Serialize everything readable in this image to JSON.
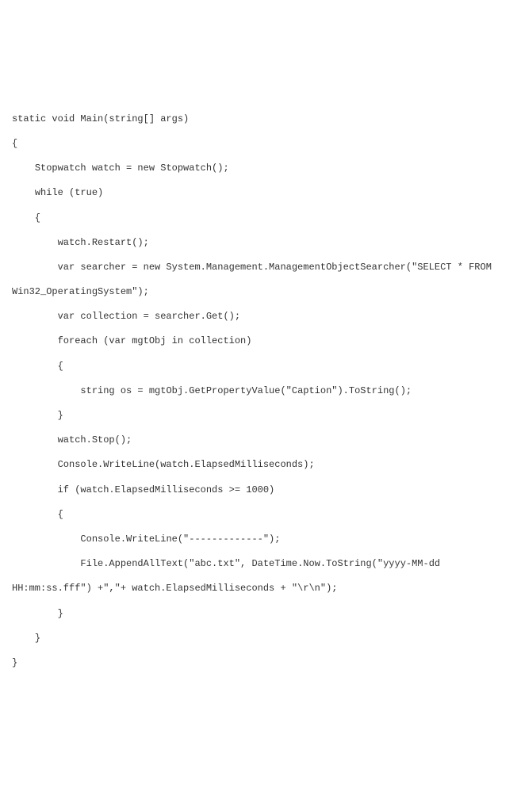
{
  "code": {
    "lines": [
      "static void Main(string[] args)",
      "{",
      "    Stopwatch watch = new Stopwatch();",
      "    while (true)",
      "    {",
      "        watch.Restart();",
      "        var searcher = new System.Management.ManagementObjectSearcher(\"SELECT * FROM Win32_OperatingSystem\");",
      "        var collection = searcher.Get();",
      "        foreach (var mgtObj in collection)",
      "        {",
      "            string os = mgtObj.GetPropertyValue(\"Caption\").ToString();",
      "        }",
      "        watch.Stop();",
      "        Console.WriteLine(watch.ElapsedMilliseconds);",
      "        if (watch.ElapsedMilliseconds >= 1000)",
      "        {",
      "            Console.WriteLine(\"-------------\");",
      "            File.AppendAllText(\"abc.txt\", DateTime.Now.ToString(\"yyyy-MM-dd HH:mm:ss.fff\") +\",\"+ watch.ElapsedMilliseconds + \"\\r\\n\");",
      "        }",
      "    }",
      "}"
    ]
  }
}
